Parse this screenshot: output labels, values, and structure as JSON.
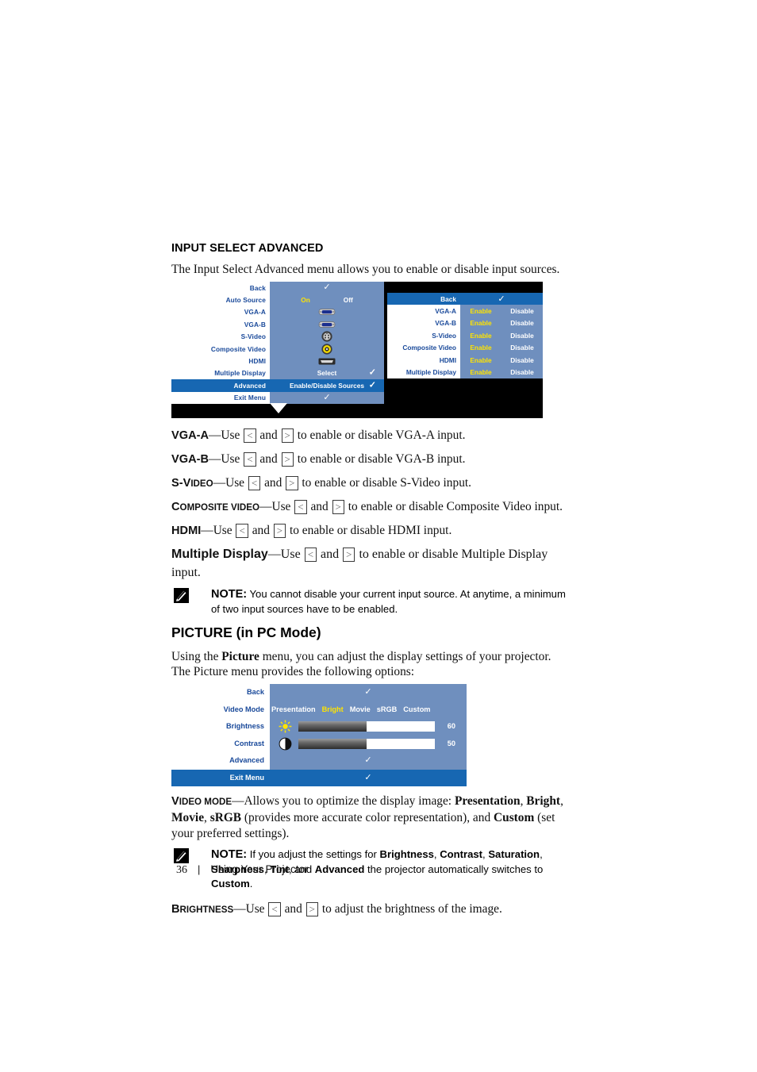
{
  "section1": {
    "heading": "INPUT SELECT ADVANCED",
    "intro": "The Input Select Advanced menu allows you to enable or disable input sources."
  },
  "osd_input_select": {
    "left_rows": [
      {
        "label": "Back",
        "type": "check"
      },
      {
        "label": "Auto Source",
        "type": "onoff",
        "on": "On",
        "off": "Off",
        "selected": "On"
      },
      {
        "label": "VGA-A",
        "type": "icon",
        "icon": "vga-connector-icon"
      },
      {
        "label": "VGA-B",
        "type": "icon",
        "icon": "vga-connector-icon"
      },
      {
        "label": "S-Video",
        "type": "icon",
        "icon": "s-video-connector-icon"
      },
      {
        "label": "Composite Video",
        "type": "icon",
        "icon": "composite-rca-connector-icon"
      },
      {
        "label": "HDMI",
        "type": "icon",
        "icon": "hdmi-connector-icon"
      },
      {
        "label": "Multiple Display",
        "type": "text-check",
        "value": "Select"
      },
      {
        "label": "Advanced",
        "type": "text-check",
        "value": "Enable/Disable Sources",
        "highlighted": true
      },
      {
        "label": "Exit Menu",
        "type": "check"
      }
    ],
    "right_panel": {
      "header_label": "Back",
      "enable_label": "Enable",
      "disable_label": "Disable",
      "rows": [
        {
          "label": "VGA-A"
        },
        {
          "label": "VGA-B"
        },
        {
          "label": "S-Video"
        },
        {
          "label": "Composite Video"
        },
        {
          "label": "HDMI"
        },
        {
          "label": "Multiple Display"
        }
      ]
    },
    "scroll_indicator": "down-triangle-icon"
  },
  "definitions": [
    {
      "term": "VGA-A",
      "style": "bold",
      "text_before": "—Use",
      "text_mid": "and",
      "text_after": "to enable or disable VGA-A input."
    },
    {
      "term": "VGA-B",
      "style": "bold",
      "text_before": "—Use",
      "text_mid": "and",
      "text_after": "to enable or disable VGA-B input."
    },
    {
      "term": "S-Video",
      "style": "smallcaps",
      "term_first": "S-V",
      "term_rest": "IDEO",
      "text_before": "—Use",
      "text_mid": "and",
      "text_after": "to enable or disable S-Video input."
    },
    {
      "term": "Composite Video",
      "style": "smallcaps",
      "term_first": "C",
      "term_rest": "OMPOSITE V",
      "term_first2": "IDEO",
      "text_before": "—Use",
      "text_mid": "and",
      "text_after": "to enable or disable Composite Video input."
    },
    {
      "term": "HDMI",
      "style": "bold",
      "text_before": "—Use",
      "text_mid": "and",
      "text_after": "to enable or disable HDMI input."
    },
    {
      "term": "Multiple Display",
      "style": "bold-large",
      "text_before": "—Use",
      "text_mid": "and",
      "text_after": "to enable or disable Multiple Display input."
    }
  ],
  "note1": {
    "label": "NOTE:",
    "text": "You cannot disable your current input source. At anytime, a minimum of two input sources have to be enabled."
  },
  "section2": {
    "heading": "PICTURE (in PC Mode)",
    "intro_a": "Using the ",
    "intro_b": "Picture",
    "intro_c": " menu, you can adjust the display settings of your projector. The Picture menu provides the following options:"
  },
  "osd_picture": {
    "rows": {
      "back": "Back",
      "video_mode": "Video Mode",
      "brightness": "Brightness",
      "contrast": "Contrast",
      "advanced": "Advanced",
      "exit_menu": "Exit Menu"
    },
    "video_modes": [
      "Presentation",
      "Bright",
      "Movie",
      "sRGB",
      "Custom"
    ],
    "video_mode_selected": "Bright",
    "brightness_value": "60",
    "brightness_percent": 50,
    "contrast_value": "50",
    "contrast_percent": 50,
    "brightness_icon": "sun-brightness-icon",
    "contrast_icon": "half-circle-contrast-icon"
  },
  "video_mode_def": {
    "term_a": "V",
    "term_b": "IDEO MODE",
    "t1": "—Allows you to optimize the display image: ",
    "b1": "Presentation",
    "t2": ", ",
    "b2": "Bright",
    "t3": ", ",
    "b3": "Movie",
    "t4": ", ",
    "b4": "sRGB",
    "t5": " (provides more accurate color representation), and ",
    "b5": "Custom",
    "t6": " (set your preferred settings)."
  },
  "note2": {
    "label": "NOTE:",
    "t1": "If you adjust the settings for ",
    "b1": "Brightness",
    "t2": ", ",
    "b2": "Contrast",
    "t3": ", ",
    "b3": "Saturation",
    "t4": ", ",
    "b4": "Sharpness",
    "t5": ", ",
    "b5": "Tint",
    "t6": ", and ",
    "b6": "Advanced",
    "t7": " the projector automatically switches to ",
    "b7": "Custom",
    "t8": "."
  },
  "brightness_def": {
    "term_a": "B",
    "term_b": "RIGHTNESS",
    "text_before": "—Use",
    "text_mid": "and",
    "text_after": "to adjust the brightness of the image."
  },
  "keys": {
    "left": "<",
    "right": ">"
  },
  "footer": {
    "page_number": "36",
    "separator": "|",
    "title": "Using Your Projector"
  },
  "colors": {
    "osd_highlight_blue": "#1767b2",
    "osd_panel_blue": "#6f8fbe",
    "osd_label_blue": "#19499a",
    "osd_yellow": "#ffe400",
    "osd_white": "#ffffff",
    "osd_black": "#000000"
  }
}
